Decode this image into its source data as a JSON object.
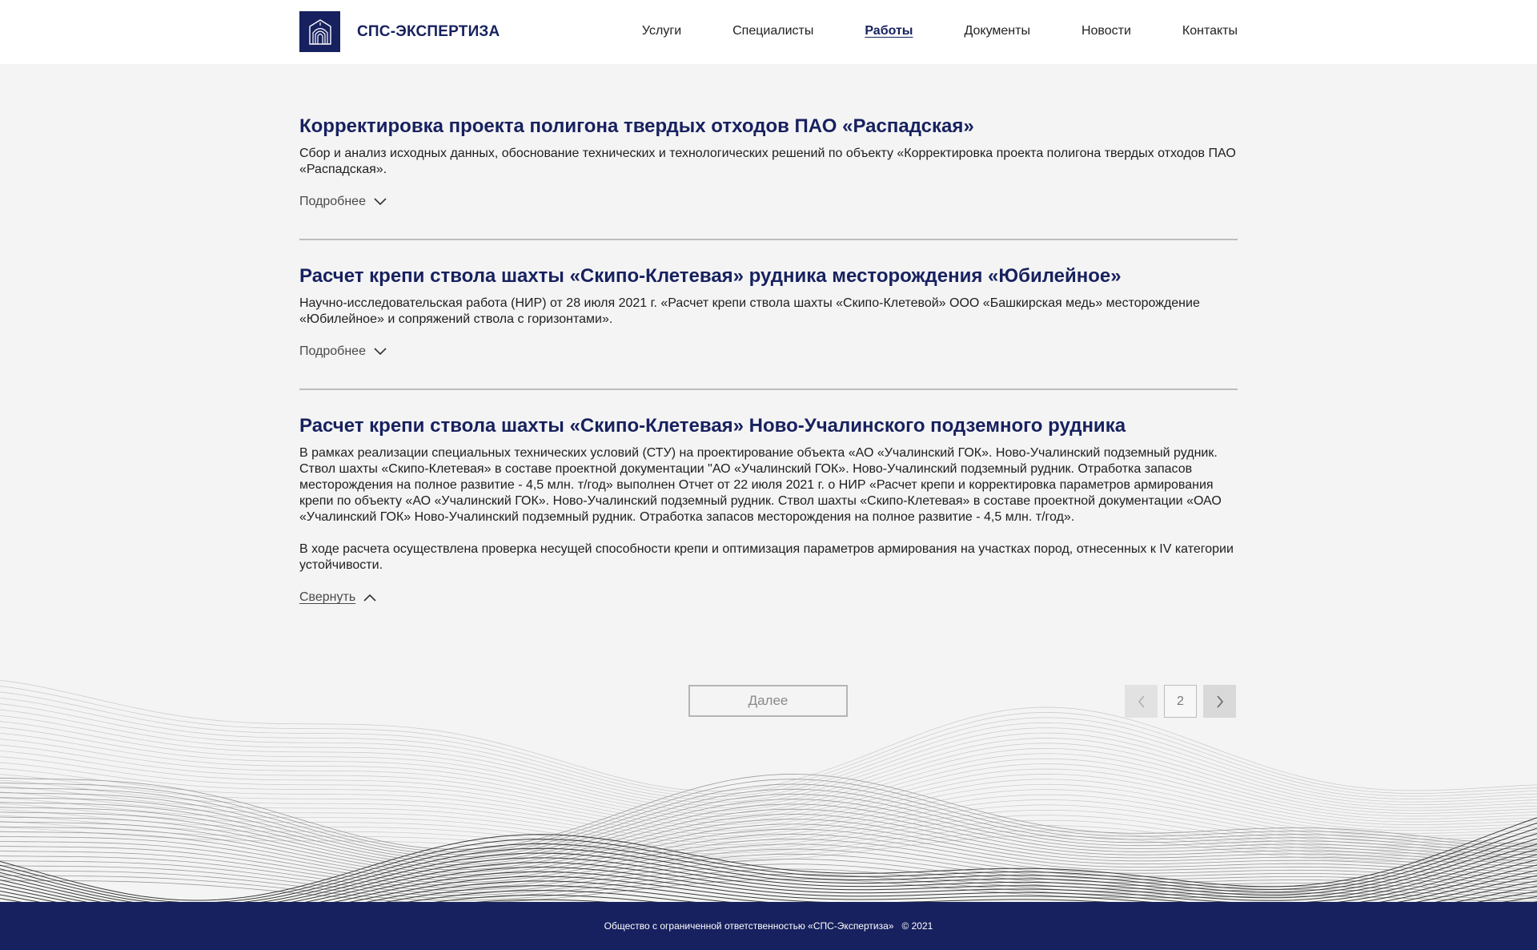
{
  "brand": {
    "name": "СПС-ЭКСПЕРТИЗА",
    "logo_color": "#17215f"
  },
  "nav": {
    "items": [
      "Услуги",
      "Специалисты",
      "Работы",
      "Документы",
      "Новости",
      "Контакты"
    ],
    "active": "Работы"
  },
  "works": [
    {
      "title": "Корректировка проекта полигона твердых отходов ПАО «Распадская»",
      "paragraphs": [
        "Сбор и анализ исходных данных, обоснование технических и технологических решений по объекту «Корректировка проекта полигона твердых отходов ПАО «Распадская»."
      ],
      "toggle_label": "Подробнее",
      "expanded": false
    },
    {
      "title": "Расчет крепи ствола шахты «Скипо-Клетевая» рудника месторождения «Юбилейное»",
      "paragraphs": [
        "Научно-исследовательская работа (НИР) от 28 июля 2021 г. «Расчет крепи ствола шахты «Скипо-Клетевой» ООО «Башкирская медь» месторождение «Юбилейное» и сопряжений ствола с горизонтами»."
      ],
      "toggle_label": "Подробнее",
      "expanded": false
    },
    {
      "title": "Расчет крепи ствола шахты «Скипо-Клетевая» Ново-Учалинского подземного рудника",
      "paragraphs": [
        "В рамках реализации специальных технических условий (СТУ) на проектирование объекта «АО «Учалинский ГОК». Ново-Учалинский подземный рудник. Ствол шахты «Скипо-Клетевая» в составе проектной документации \"АО «Учалинский ГОК». Ново-Учалинский подземный рудник. Отработка запасов месторождения на полное развитие - 4,5 млн. т/год» выполнен Отчет от 22 июля 2021 г. о НИР «Расчет крепи и корректировка параметров армирования крепи по объекту «АО «Учалинский ГОК». Ново-Учалинский подземный рудник. Ствол шахты «Скипо-Клетевая» в составе проектной документации «ОАО «Учалинский ГОК» Ново-Учалинский подземный рудник. Отработка запасов месторождения на полное развитие - 4,5 млн. т/год».",
        "В ходе расчета осуществлена проверка несущей способности крепи и оптимизация параметров армирования на участках пород, отнесенных к IV категории устойчивости."
      ],
      "toggle_label": "Свернуть",
      "expanded": true
    }
  ],
  "pagination": {
    "load_more_label": "Далее",
    "current_page": "2"
  },
  "footer": {
    "company": "Общество с ограниченной ответственностью «СПС-Экспертиза»",
    "copyright": "© 2021"
  }
}
